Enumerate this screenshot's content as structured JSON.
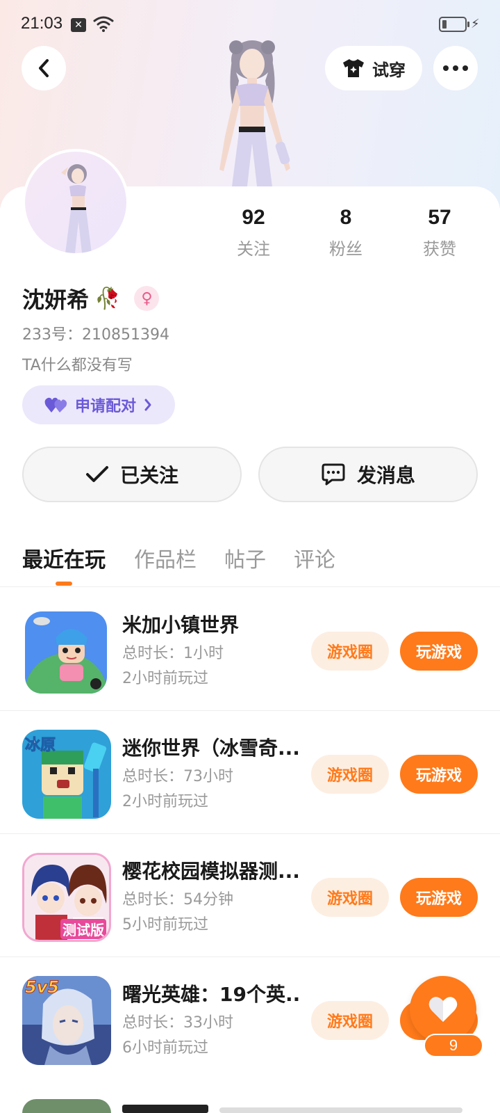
{
  "status_bar": {
    "time": "21:03"
  },
  "header": {
    "try_on_label": "试穿"
  },
  "profile": {
    "name": "沈妍希",
    "uid": "233号：210851394",
    "bio": "TA什么都没有写",
    "pair_label": "申请配对",
    "stats": [
      {
        "value": "92",
        "label": "关注"
      },
      {
        "value": "8",
        "label": "粉丝"
      },
      {
        "value": "57",
        "label": "获赞"
      }
    ]
  },
  "actions": {
    "following_label": "已关注",
    "message_label": "发消息"
  },
  "tabs": [
    {
      "label": "最近在玩",
      "active": true
    },
    {
      "label": "作品栏",
      "active": false
    },
    {
      "label": "帖子",
      "active": false
    },
    {
      "label": "评论",
      "active": false
    }
  ],
  "games": [
    {
      "title": "米加小镇世界",
      "duration": "总时长：1小时",
      "last_played": "2小时前玩过",
      "circle_label": "游戏圈",
      "play_label": "玩游戏"
    },
    {
      "title": "迷你世界（冰雪奇...",
      "duration": "总时长：73小时",
      "last_played": "2小时前玩过",
      "circle_label": "游戏圈",
      "play_label": "玩游戏"
    },
    {
      "title": "樱花校园模拟器测...",
      "duration": "总时长：54分钟",
      "last_played": "5小时前玩过",
      "circle_label": "游戏圈",
      "play_label": "玩游戏"
    },
    {
      "title": "曙光英雄：19个英...",
      "duration": "总时长：33小时",
      "last_played": "6小时前玩过",
      "circle_label": "游戏圈",
      "play_label": "玩游戏"
    }
  ],
  "game_icon_texts": {
    "mini_world": "冰原",
    "sakura": "测试版",
    "dawn": "5v5"
  },
  "like": {
    "count": "9"
  },
  "colors": {
    "accent": "#ff7a1a",
    "accent_light": "#fdeee2",
    "pair_purple": "#6a5ad8"
  }
}
